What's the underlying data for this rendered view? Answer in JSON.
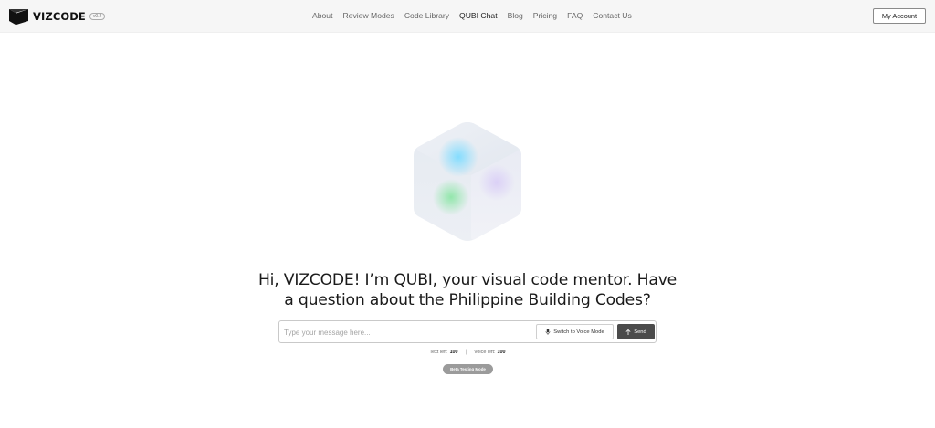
{
  "header": {
    "logo": {
      "text": "VIZCODE",
      "badge": "v0.2"
    },
    "nav": [
      {
        "label": "About",
        "active": false
      },
      {
        "label": "Review Modes",
        "active": false
      },
      {
        "label": "Code Library",
        "active": false
      },
      {
        "label": "QUBI Chat",
        "active": true
      },
      {
        "label": "Blog",
        "active": false
      },
      {
        "label": "Pricing",
        "active": false
      },
      {
        "label": "FAQ",
        "active": false
      },
      {
        "label": "Contact Us",
        "active": false
      }
    ],
    "account_label": "My Account"
  },
  "main": {
    "greeting_line1": "Hi, VIZCODE! I’m QUBI, your visual code mentor. Have",
    "greeting_line2": "a question about the Philippine Building Codes?",
    "chat": {
      "value": "",
      "placeholder": "Type your message here...",
      "voice_label": "Switch to Voice Mode",
      "voice_icon": "microphone-icon",
      "send_label": "Send",
      "send_icon": "arrow-up-icon"
    },
    "usage": {
      "text_label": "Text left:",
      "text_value": "100",
      "separator": "|",
      "voice_label": "Voice left:",
      "voice_value": "100"
    },
    "beta_label": "Beta Testing Mode"
  },
  "colors": {
    "header_bg": "#f6f6f6",
    "send_bg": "#4b4b4b",
    "beta_bg": "#9b9b9b",
    "cube_glow_blue": "#7fdcff",
    "cube_glow_green": "#8ee6a8",
    "cube_glow_lavender": "#d9cdf7"
  }
}
